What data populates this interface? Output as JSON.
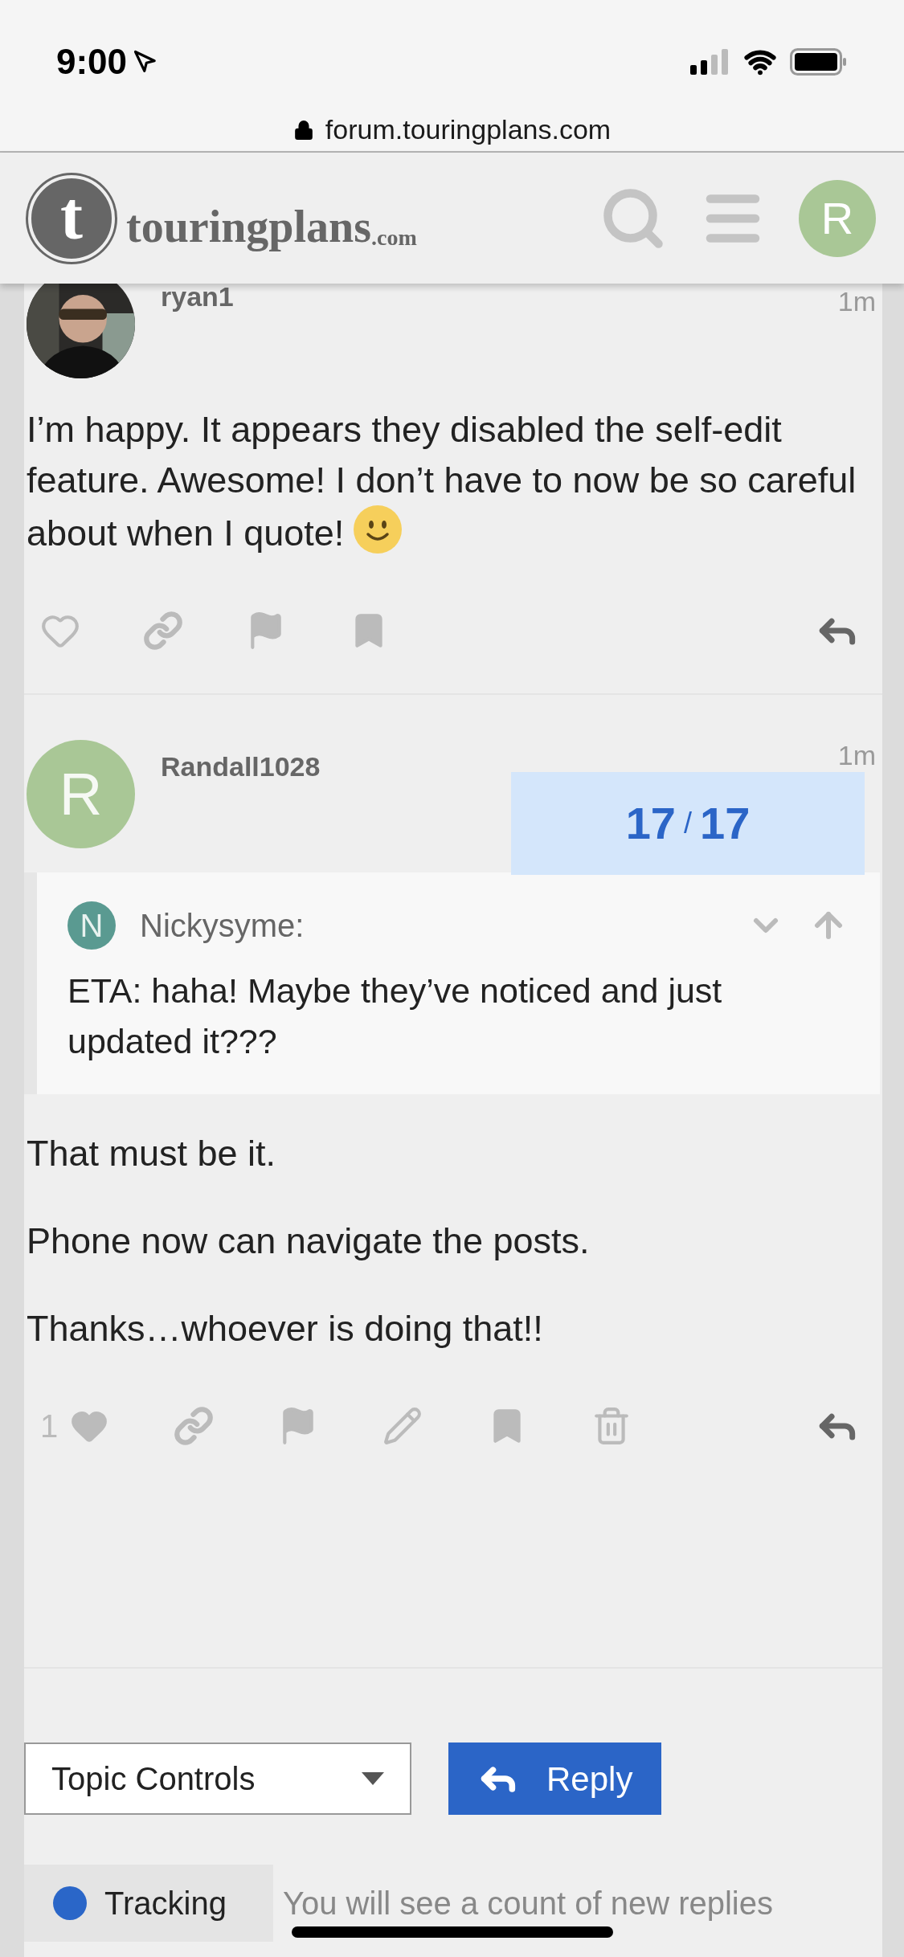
{
  "status_bar": {
    "time": "9:00",
    "url": "forum.touringplans.com"
  },
  "header": {
    "logo_letter": "t",
    "logo_text": "touringplans",
    "logo_suffix": ".com",
    "user_letter": "R"
  },
  "posts": [
    {
      "author": "ryan1",
      "time": "1m",
      "avatar": {
        "kind": "picture"
      },
      "paragraphs": [
        "I’m happy. It appears they disabled the self-edit feature. Awesome! I don’t have to now be so careful about when I quote!"
      ],
      "smiley": true,
      "actions": [
        {
          "kind": "like",
          "filled": false
        },
        {
          "kind": "link"
        },
        {
          "kind": "flag"
        },
        {
          "kind": "bookmark"
        },
        {
          "kind": "reply"
        }
      ]
    },
    {
      "author": "Randall1028",
      "time": "1m",
      "avatar": {
        "kind": "letter",
        "letter": "R",
        "color": "#a9c796"
      },
      "quote": {
        "letter": "N",
        "color": "#5a9a91",
        "author": "Nickysyme:",
        "text": "ETA: haha! Maybe they’ve noticed and just updated it???"
      },
      "paragraphs": [
        "That must be it.",
        "Phone now can navigate the posts.",
        "Thanks…whoever is doing that!!"
      ],
      "smiley": false,
      "actions": [
        {
          "kind": "like",
          "filled": true,
          "count": "1"
        },
        {
          "kind": "link"
        },
        {
          "kind": "flag"
        },
        {
          "kind": "edit"
        },
        {
          "kind": "bookmark"
        },
        {
          "kind": "delete"
        },
        {
          "kind": "reply"
        }
      ]
    }
  ],
  "progress": {
    "current": "17",
    "separator": "/",
    "total": "17"
  },
  "footer": {
    "topic_controls": "Topic Controls",
    "reply": "Reply",
    "tracking": {
      "label": "Tracking",
      "color": "#2a66c8",
      "description": "You will see a count of new replies"
    }
  }
}
